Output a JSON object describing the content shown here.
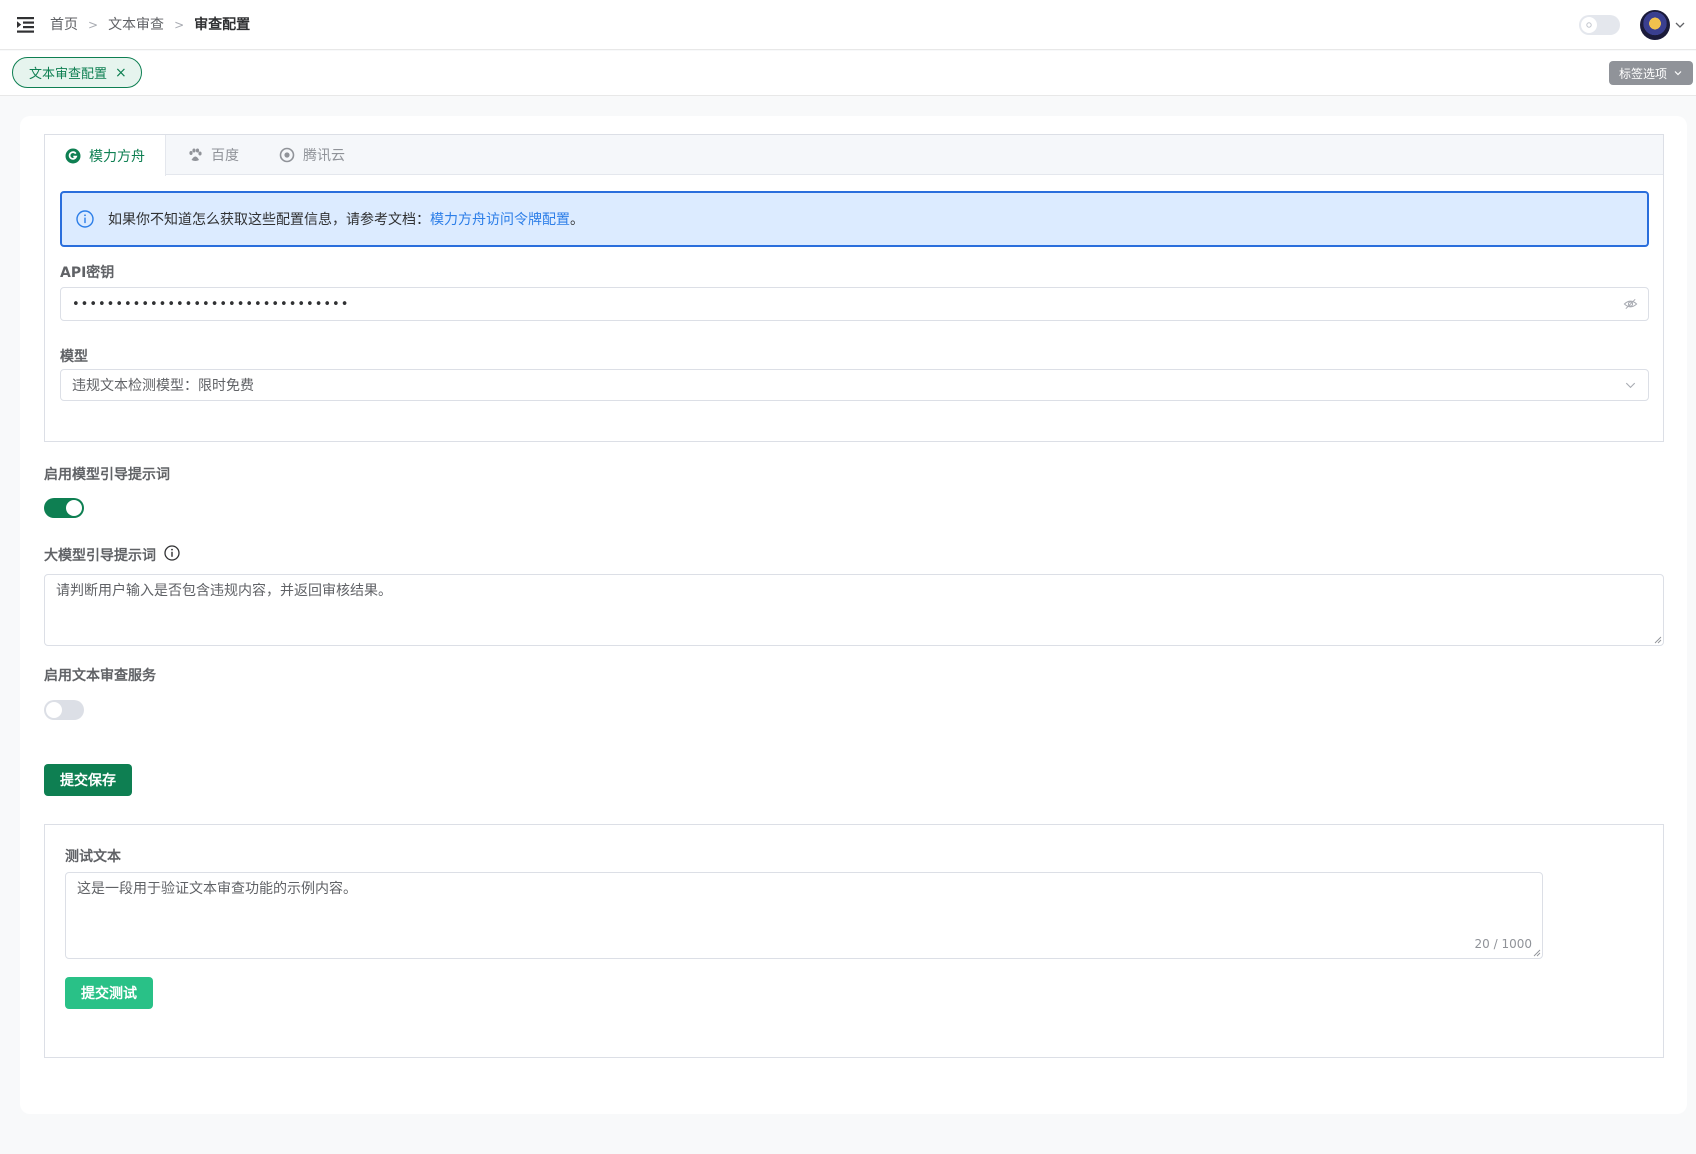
{
  "header": {
    "breadcrumbs": [
      "首页",
      "文本审查",
      "审查配置"
    ]
  },
  "tags": {
    "active_tag": "文本审查配置",
    "close_symbol": "×",
    "options_label": "标签选项"
  },
  "tabs": [
    {
      "label": "模力方舟",
      "icon": "g-logo-icon",
      "active": true
    },
    {
      "label": "百度",
      "icon": "paw-icon",
      "active": false
    },
    {
      "label": "腾讯云",
      "icon": "tencent-cloud-icon",
      "active": false
    }
  ],
  "alert": {
    "text": "如果你不知道怎么获取这些配置信息，请参考文档：",
    "link_text": "模力方舟访问令牌配置",
    "suffix": "。"
  },
  "form": {
    "api_key_label": "API密钥",
    "api_key_value": "••••••••••••••••••••••••••••••••",
    "model_label": "模型",
    "model_value": "违规文本检测模型：限时免费",
    "enable_prompt_label": "启用模型引导提示词",
    "enable_prompt_on": true,
    "prompt_label": "大模型引导提示词",
    "prompt_value": "请判断用户输入是否包含违规内容，并返回审核结果。",
    "enable_service_label": "启用文本审查服务",
    "enable_service_on": false,
    "submit_label": "提交保存"
  },
  "test": {
    "label": "测试文本",
    "value": "这是一段用于验证文本审查功能的示例内容。",
    "counter": "20 / 1000",
    "submit_label": "提交测试"
  },
  "colors": {
    "primary": "#0e7f52",
    "test_button": "#29c187",
    "alert_bg": "#dcebff",
    "alert_border": "#2a6edc",
    "link": "#2c7ee8"
  }
}
